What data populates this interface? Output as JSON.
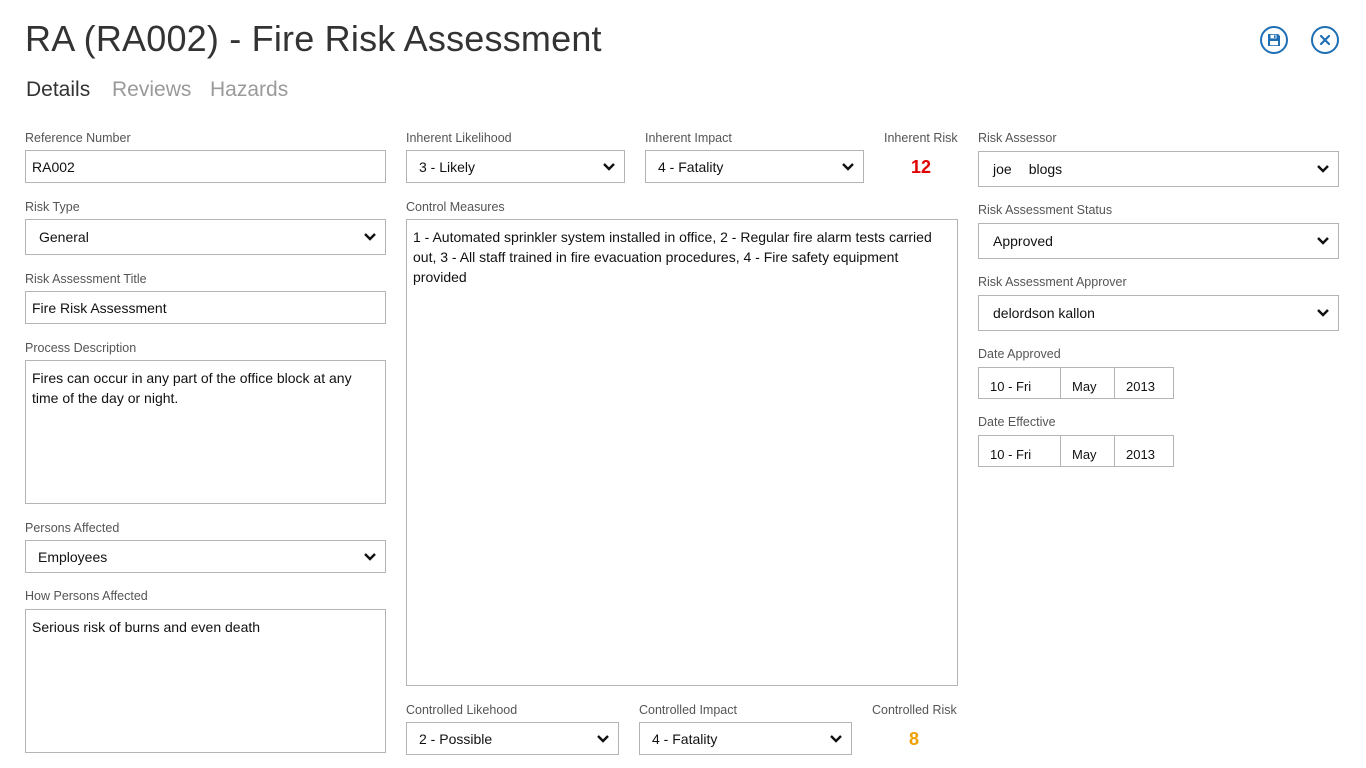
{
  "header": {
    "title": "RA (RA002) - Fire Risk Assessment",
    "save_icon": "save-icon",
    "close_icon": "close-icon",
    "accent": "#1f6fb5"
  },
  "tabs": [
    {
      "label": "Details",
      "active": true
    },
    {
      "label": "Reviews",
      "active": false
    },
    {
      "label": "Hazards",
      "active": false
    }
  ],
  "left": {
    "reference_number": {
      "label": "Reference Number",
      "value": "RA002"
    },
    "risk_type": {
      "label": "Risk Type",
      "value": "General"
    },
    "title": {
      "label": "Risk Assessment Title",
      "value": "Fire Risk Assessment"
    },
    "process_description": {
      "label": "Process Description",
      "value": "Fires can occur in any part of the office block at any time of the day or night."
    },
    "persons_affected": {
      "label": "Persons Affected",
      "value": "Employees"
    },
    "how_persons_affected": {
      "label": "How Persons Affected",
      "value": "Serious risk of burns and even death"
    }
  },
  "middle": {
    "inherent_likelihood": {
      "label": "Inherent Likelihood",
      "value": "3 - Likely"
    },
    "inherent_impact": {
      "label": "Inherent Impact",
      "value": "4 - Fatality"
    },
    "inherent_risk": {
      "label": "Inherent Risk",
      "value": "12",
      "color": "#e00000"
    },
    "control_measures": {
      "label": "Control Measures",
      "value": "1 - Automated sprinkler system installed in office, 2 - Regular fire alarm tests carried out, 3 - All staff trained in fire evacuation procedures, 4 - Fire safety equipment provided"
    },
    "controlled_likelihood": {
      "label": "Controlled Likehood",
      "value": "2 - Possible"
    },
    "controlled_impact": {
      "label": "Controlled Impact",
      "value": "4 - Fatality"
    },
    "controlled_risk": {
      "label": "Controlled Risk",
      "value": "8",
      "color": "#f0a000"
    }
  },
  "right": {
    "risk_assessor": {
      "label": "Risk Assessor",
      "first": "joe",
      "last": "blogs"
    },
    "status": {
      "label": "Risk Assessment Status",
      "value": "Approved"
    },
    "approver": {
      "label": "Risk Assessment Approver",
      "value": "delordson kallon"
    },
    "date_approved": {
      "label": "Date Approved",
      "day": "10 - Fri",
      "month": "May",
      "year": "2013"
    },
    "date_effective": {
      "label": "Date Effective",
      "day": "10 - Fri",
      "month": "May",
      "year": "2013"
    }
  }
}
